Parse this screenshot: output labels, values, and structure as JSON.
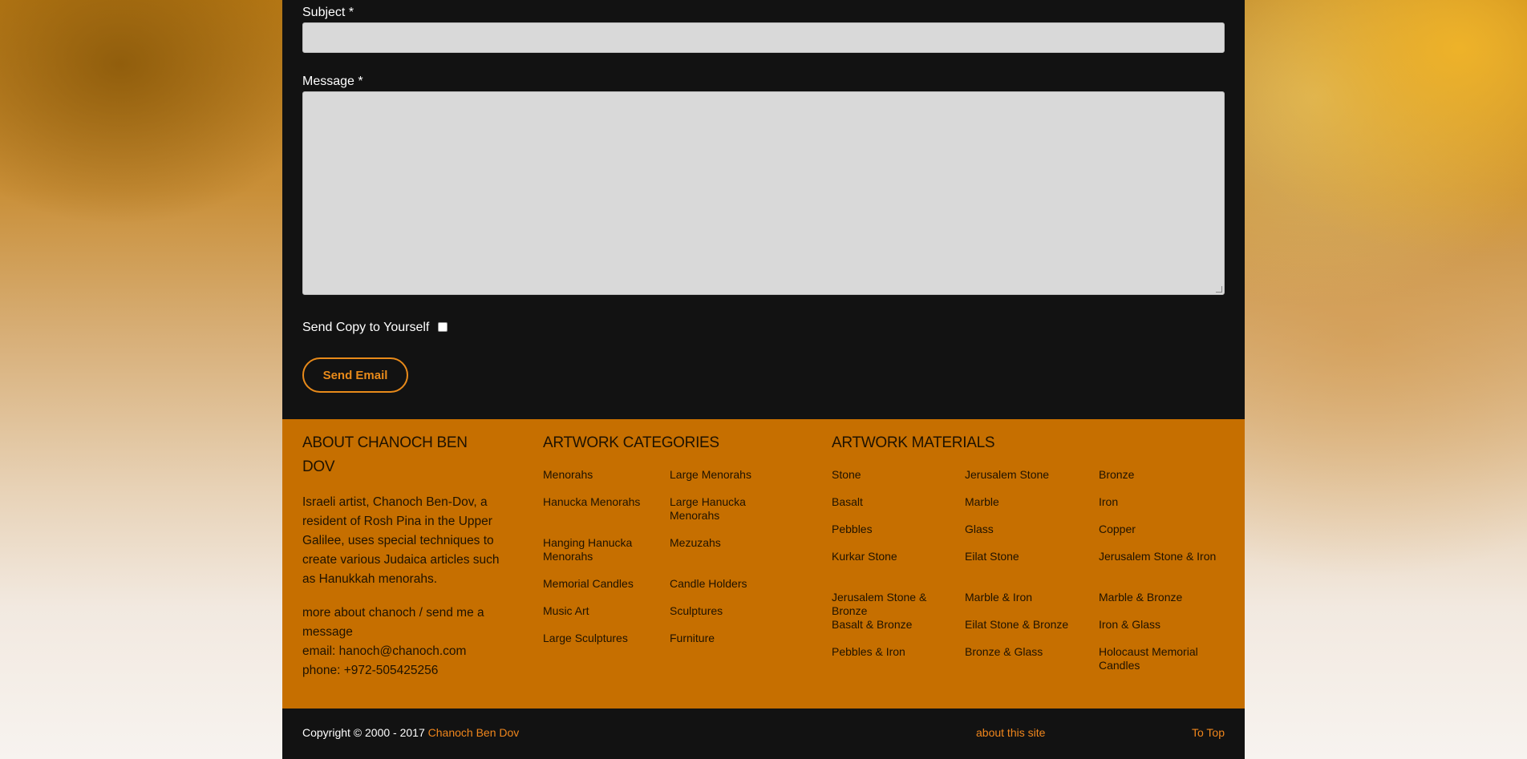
{
  "form": {
    "subject_label": "Subject *",
    "subject_value": "",
    "message_label": "Message *",
    "message_value": "",
    "copy_label": "Send Copy to Yourself",
    "copy_checked": false,
    "send_button": "Send Email"
  },
  "footer": {
    "about": {
      "heading": "ABOUT CHANOCH BEN DOV",
      "text": "Israeli artist, Chanoch Ben-Dov, a resident of Rosh Pina in the Upper Galilee, uses special techniques to create various Judaica articles such as Hanukkah menorahs.",
      "more_link": "more about chanoch",
      "separator": " / ",
      "message_link": "send me a message",
      "email": "email: hanoch@chanoch.com",
      "phone": "phone: +972-505425256"
    },
    "categories": {
      "heading": "ARTWORK CATEGORIES",
      "items": [
        "Menorahs",
        "Large Menorahs",
        "Hanucka Menorahs",
        "Large Hanucka Menorahs",
        "Hanging Hanucka Menorahs",
        "Mezuzahs",
        "Memorial Candles",
        "Candle Holders",
        "Music Art",
        "Sculptures",
        "Large Sculptures",
        "Furniture"
      ]
    },
    "materials": {
      "heading": "ARTWORK MATERIALS",
      "items": [
        "Stone",
        "Jerusalem Stone",
        "Bronze",
        "Basalt",
        "Marble",
        "Iron",
        "Pebbles",
        "Glass",
        "Copper",
        "Kurkar Stone",
        "Eilat Stone",
        "Jerusalem Stone & Iron",
        "Jerusalem Stone & Bronze",
        "Marble & Iron",
        "Marble & Bronze",
        "Basalt & Bronze",
        "Eilat Stone & Bronze",
        "Iron & Glass",
        "Pebbles & Iron",
        "Bronze & Glass",
        "Holocaust Memorial Candles"
      ]
    }
  },
  "bottom": {
    "copyright": "Copyright © 2000 - 2017 ",
    "owner_link": "Chanoch Ben Dov",
    "about_site": "about this site",
    "to_top": "To Top"
  },
  "colors": {
    "panel": "#121212",
    "footer": "#c66f00",
    "accent": "#f0861c",
    "input": "#d9d9d9"
  }
}
